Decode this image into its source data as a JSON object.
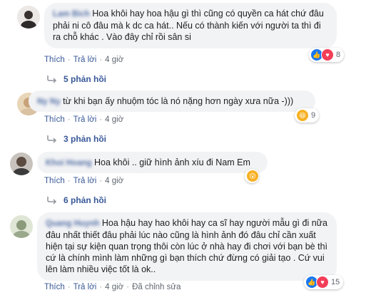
{
  "comments": [
    {
      "author": "Lam Bich",
      "text": "Hoa khôi hay hoa hậu gì thì cũng có quyền ca hát chứ đâu phải ni cô đâu mà k dc ca hát.. Nếu có thành kiến với người ta thì đi ra chỗ khác . Vào đây chỉ rồi sân si",
      "reactions": [
        "like",
        "love"
      ],
      "reaction_count": "8",
      "actions": {
        "like": "Thích",
        "reply": "Trả lời",
        "time": "4 giờ"
      },
      "replies": "5 phản hồi"
    },
    {
      "author": "Ny Ny",
      "text": "từ khi bạn ấy nhuộm tóc là nó nặng hơn ngày xưa nữa -)))",
      "reactions": [
        "haha"
      ],
      "reaction_count": "9",
      "actions": {
        "like": "Thích",
        "reply": "Trả lời",
        "time": "4 giờ"
      },
      "replies": "3 phản hồi"
    },
    {
      "author": "Khoi Hoang",
      "text": "Hoa khôi .. giữ hình ảnh xíu đi Nam Em",
      "reactions": [
        "wow"
      ],
      "reaction_count": "",
      "actions": {
        "like": "Thích",
        "reply": "Trả lời",
        "time": "4 giờ"
      },
      "replies": "6 phản hồi"
    },
    {
      "author": "Quang Huynh",
      "text": "Hoa hậu hay hao khôi hay ca sĩ hay người mẫu gì đi nữa đâu nhất thiết đâu phải lúc nào cũng là hình ảnh đó đâu chỉ cần xuất hiện tại sự kiện quan trọng thôi còn lúc ở nhà hay đi chơi với bạn bè thì cứ là chính mình làm những gì bạn thích chứ đừng có giải tạo . Cứ vui lên làm nhiều việc tốt là ok..",
      "reactions": [
        "like",
        "love"
      ],
      "reaction_count": "15",
      "actions": {
        "like": "Thích",
        "reply": "Trả lời",
        "time": "4 giờ",
        "edited": "Đã chỉnh sửa"
      }
    }
  ],
  "colors": {
    "link": "#385898",
    "bubble": "#f2f3f5",
    "meta": "#606770"
  }
}
